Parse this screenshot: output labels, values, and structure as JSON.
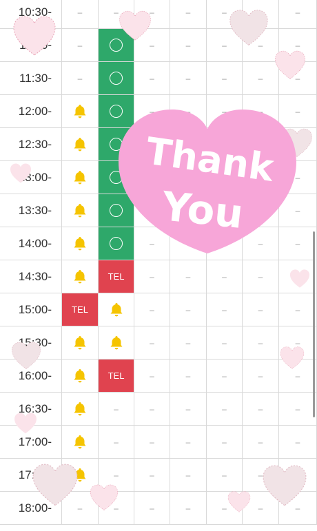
{
  "rows": [
    {
      "time": "10:30-",
      "cells": [
        "dash",
        "dash",
        "dash",
        "dash",
        "dash",
        "dash",
        "dash"
      ]
    },
    {
      "time": "11:00-",
      "cells": [
        "dash",
        "circle",
        "dash",
        "dash",
        "dash",
        "dash",
        "dash"
      ]
    },
    {
      "time": "11:30-",
      "cells": [
        "dash",
        "circle",
        "dash",
        "dash",
        "dash",
        "dash",
        "dash"
      ]
    },
    {
      "time": "12:00-",
      "cells": [
        "bell",
        "circle",
        "dash",
        "dash",
        "dash",
        "dash",
        "dash"
      ]
    },
    {
      "time": "12:30-",
      "cells": [
        "bell",
        "circle",
        "dash",
        "dash",
        "dash",
        "dash",
        "dash"
      ]
    },
    {
      "time": "13:00-",
      "cells": [
        "bell",
        "circle",
        "dash",
        "dash",
        "dash",
        "dash",
        "dash"
      ]
    },
    {
      "time": "13:30-",
      "cells": [
        "bell",
        "circle",
        "dash",
        "dash",
        "dash",
        "dash",
        "dash"
      ]
    },
    {
      "time": "14:00-",
      "cells": [
        "bell",
        "circle",
        "dash",
        "dash",
        "dash",
        "dash",
        "dash"
      ]
    },
    {
      "time": "14:30-",
      "cells": [
        "bell",
        "tel",
        "dash",
        "dash",
        "dash",
        "dash",
        "dash"
      ]
    },
    {
      "time": "15:00-",
      "cells": [
        "tel",
        "bell",
        "dash",
        "dash",
        "dash",
        "dash",
        "dash"
      ]
    },
    {
      "time": "15:30-",
      "cells": [
        "bell",
        "bell",
        "dash",
        "dash",
        "dash",
        "dash",
        "dash"
      ]
    },
    {
      "time": "16:00-",
      "cells": [
        "bell",
        "tel",
        "dash",
        "dash",
        "dash",
        "dash",
        "dash"
      ]
    },
    {
      "time": "16:30-",
      "cells": [
        "bell",
        "dash",
        "dash",
        "dash",
        "dash",
        "dash",
        "dash"
      ]
    },
    {
      "time": "17:00-",
      "cells": [
        "bell",
        "dash",
        "dash",
        "dash",
        "dash",
        "dash",
        "dash"
      ]
    },
    {
      "time": "17:30-",
      "cells": [
        "bell",
        "dash",
        "dash",
        "dash",
        "dash",
        "dash",
        "dash"
      ]
    },
    {
      "time": "18:00-",
      "cells": [
        "dash",
        "dash",
        "dash",
        "dash",
        "dash",
        "dash",
        "dash"
      ]
    }
  ],
  "labels": {
    "tel": "TEL",
    "dash": "–"
  },
  "overlay": {
    "line1": "Thank",
    "line2": "You"
  },
  "colors": {
    "available": "#2ea86a",
    "tel": "#e0434f",
    "bell": "#f5c400",
    "heart": "#f7a6d8"
  }
}
